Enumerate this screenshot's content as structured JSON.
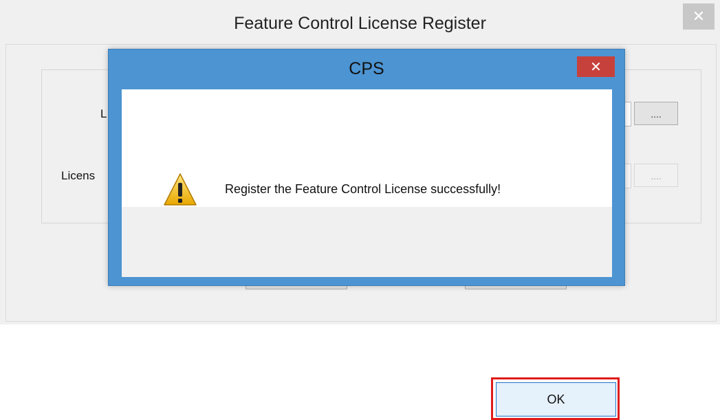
{
  "background_window": {
    "title": "Feature Control License Register",
    "close_glyph": "✕",
    "label1_partial": "L",
    "label2_partial": "Licens",
    "browse1_label": "....",
    "browse2_label": "...."
  },
  "dialog": {
    "title": "CPS",
    "close_glyph": "✕",
    "icon": "warning-icon",
    "message": "Register the Feature Control License successfully!",
    "ok_label": "OK",
    "highlight_color": "#e01a1a"
  }
}
